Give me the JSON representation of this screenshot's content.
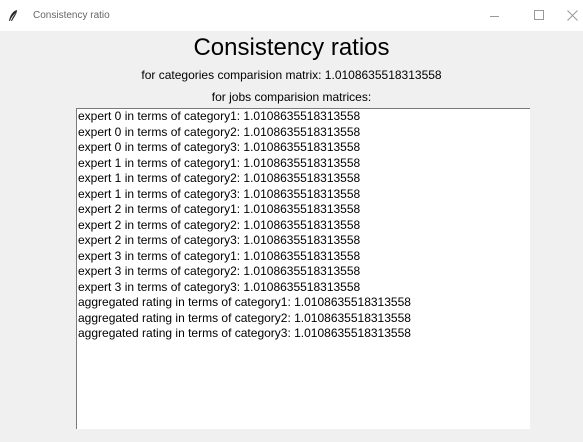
{
  "window": {
    "title": "Consistency ratio",
    "icon": "feather-icon"
  },
  "heading": "Consistency ratios",
  "categories_line": "for categories comparision matrix: 1.0108635518313558",
  "jobs_heading": "for jobs comparision matrices:",
  "results": [
    "expert 0 in terms of category1: 1.0108635518313558",
    "expert 0 in terms of category2: 1.0108635518313558",
    "expert 0 in terms of category3: 1.0108635518313558",
    "expert 1 in terms of category1: 1.0108635518313558",
    "expert 1 in terms of category2: 1.0108635518313558",
    "expert 1 in terms of category3: 1.0108635518313558",
    "expert 2 in terms of category1: 1.0108635518313558",
    "expert 2 in terms of category2: 1.0108635518313558",
    "expert 2 in terms of category3: 1.0108635518313558",
    "expert 3 in terms of category1: 1.0108635518313558",
    "expert 3 in terms of category2: 1.0108635518313558",
    "expert 3 in terms of category3: 1.0108635518313558",
    "aggregated rating in terms of category1: 1.0108635518313558",
    "aggregated rating in terms of category2: 1.0108635518313558",
    "aggregated rating in terms of category3: 1.0108635518313558"
  ]
}
